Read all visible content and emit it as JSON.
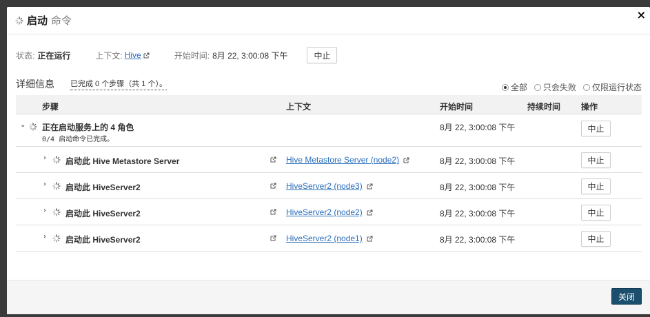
{
  "header": {
    "title_strong": "启动",
    "title_sub": "命令"
  },
  "status": {
    "state_label": "状态:",
    "state_value": "正在运行",
    "context_label": "上下文:",
    "context_link": "Hive",
    "start_label": "开始时间:",
    "start_value": "8月 22, 3:00:08 下午",
    "stop_label": "中止"
  },
  "details": {
    "title": "详细信息",
    "steps_done": "已完成 0 个步骤（共 1 个）。",
    "filters": [
      {
        "label": "全部",
        "selected": true
      },
      {
        "label": "只会失败",
        "selected": false
      },
      {
        "label": "仅限运行状态",
        "selected": false
      }
    ]
  },
  "table": {
    "columns": {
      "step": "步骤",
      "context": "上下文",
      "start": "开始时间",
      "duration": "持续时间",
      "action": "操作"
    },
    "parent": {
      "name": "正在启动服务上的 4 角色",
      "sub": "0/4 启动命令已完成。",
      "start": "8月 22, 3:00:08 下午",
      "action": "中止"
    },
    "children": [
      {
        "name": "启动此 Hive Metastore Server",
        "context": "Hive Metastore Server (node2)",
        "start": "8月 22, 3:00:08 下午",
        "action": "中止"
      },
      {
        "name": "启动此 HiveServer2",
        "context": "HiveServer2 (node3)",
        "start": "8月 22, 3:00:08 下午",
        "action": "中止"
      },
      {
        "name": "启动此 HiveServer2",
        "context": "HiveServer2 (node2)",
        "start": "8月 22, 3:00:08 下午",
        "action": "中止"
      },
      {
        "name": "启动此 HiveServer2",
        "context": "HiveServer2 (node1)",
        "start": "8月 22, 3:00:08 下午",
        "action": "中止"
      }
    ]
  },
  "footer": {
    "close_label": "关闭"
  },
  "colors": {
    "link": "#2a6ebb",
    "primary": "#1c4f6e"
  }
}
